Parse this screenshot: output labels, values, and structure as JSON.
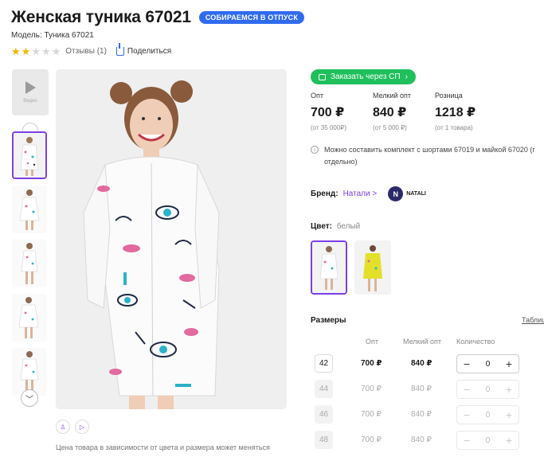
{
  "product": {
    "title": "Женская туника 67021",
    "promo_badge": "СОБИРАЕМСЯ В ОТПУСК",
    "model_line": "Модель: Туника 67021",
    "rating": 2,
    "rating_max": 5,
    "reviews_label": "Отзывы (1)",
    "share_label": "Поделиться"
  },
  "gallery": {
    "video_label": "Видео",
    "thumbnail_count": 5,
    "selected_thumbnail": 1,
    "price_note": "Цена товара в зависимости от цвета и размера может меняться"
  },
  "order_button": {
    "label": "Заказать через СП",
    "chevron": "›"
  },
  "prices": [
    {
      "label": "Опт",
      "value": "700 ₽",
      "min": "(от 35 000₽)"
    },
    {
      "label": "Мелкий опт",
      "value": "840 ₽",
      "min": "(от 5 000 ₽)"
    },
    {
      "label": "Розница",
      "value": "1218 ₽",
      "min": "(от 1 товара)"
    }
  ],
  "info_note": "Можно составить комплект с шортами 67019 и майкой 67020 (г отдельно)",
  "brand": {
    "label": "Бренд:",
    "name": "Натали",
    "chevron": ">",
    "logo_text": "NATALI",
    "logo_letter": "N"
  },
  "color": {
    "label": "Цвет:",
    "value": "белый"
  },
  "sizes": {
    "title": "Размеры",
    "table_link": "Таблиц",
    "headers": {
      "opt": "Опт",
      "small_opt": "Мелкий опт",
      "quantity": "Количество"
    },
    "rows": [
      {
        "size": "42",
        "opt": "700 ₽",
        "small_opt": "840 ₽",
        "qty": "0",
        "available": true
      },
      {
        "size": "44",
        "opt": "700 ₽",
        "small_opt": "840 ₽",
        "qty": "0",
        "available": false
      },
      {
        "size": "46",
        "opt": "700 ₽",
        "small_opt": "840 ₽",
        "qty": "0",
        "available": false
      },
      {
        "size": "48",
        "opt": "700 ₽",
        "small_opt": "840 ₽",
        "qty": "0",
        "available": false
      }
    ]
  },
  "colors": {
    "accent": "#7b3fe4",
    "badge": "#2f6bf0",
    "green": "#1fbf5c",
    "star": "#f5b400"
  }
}
